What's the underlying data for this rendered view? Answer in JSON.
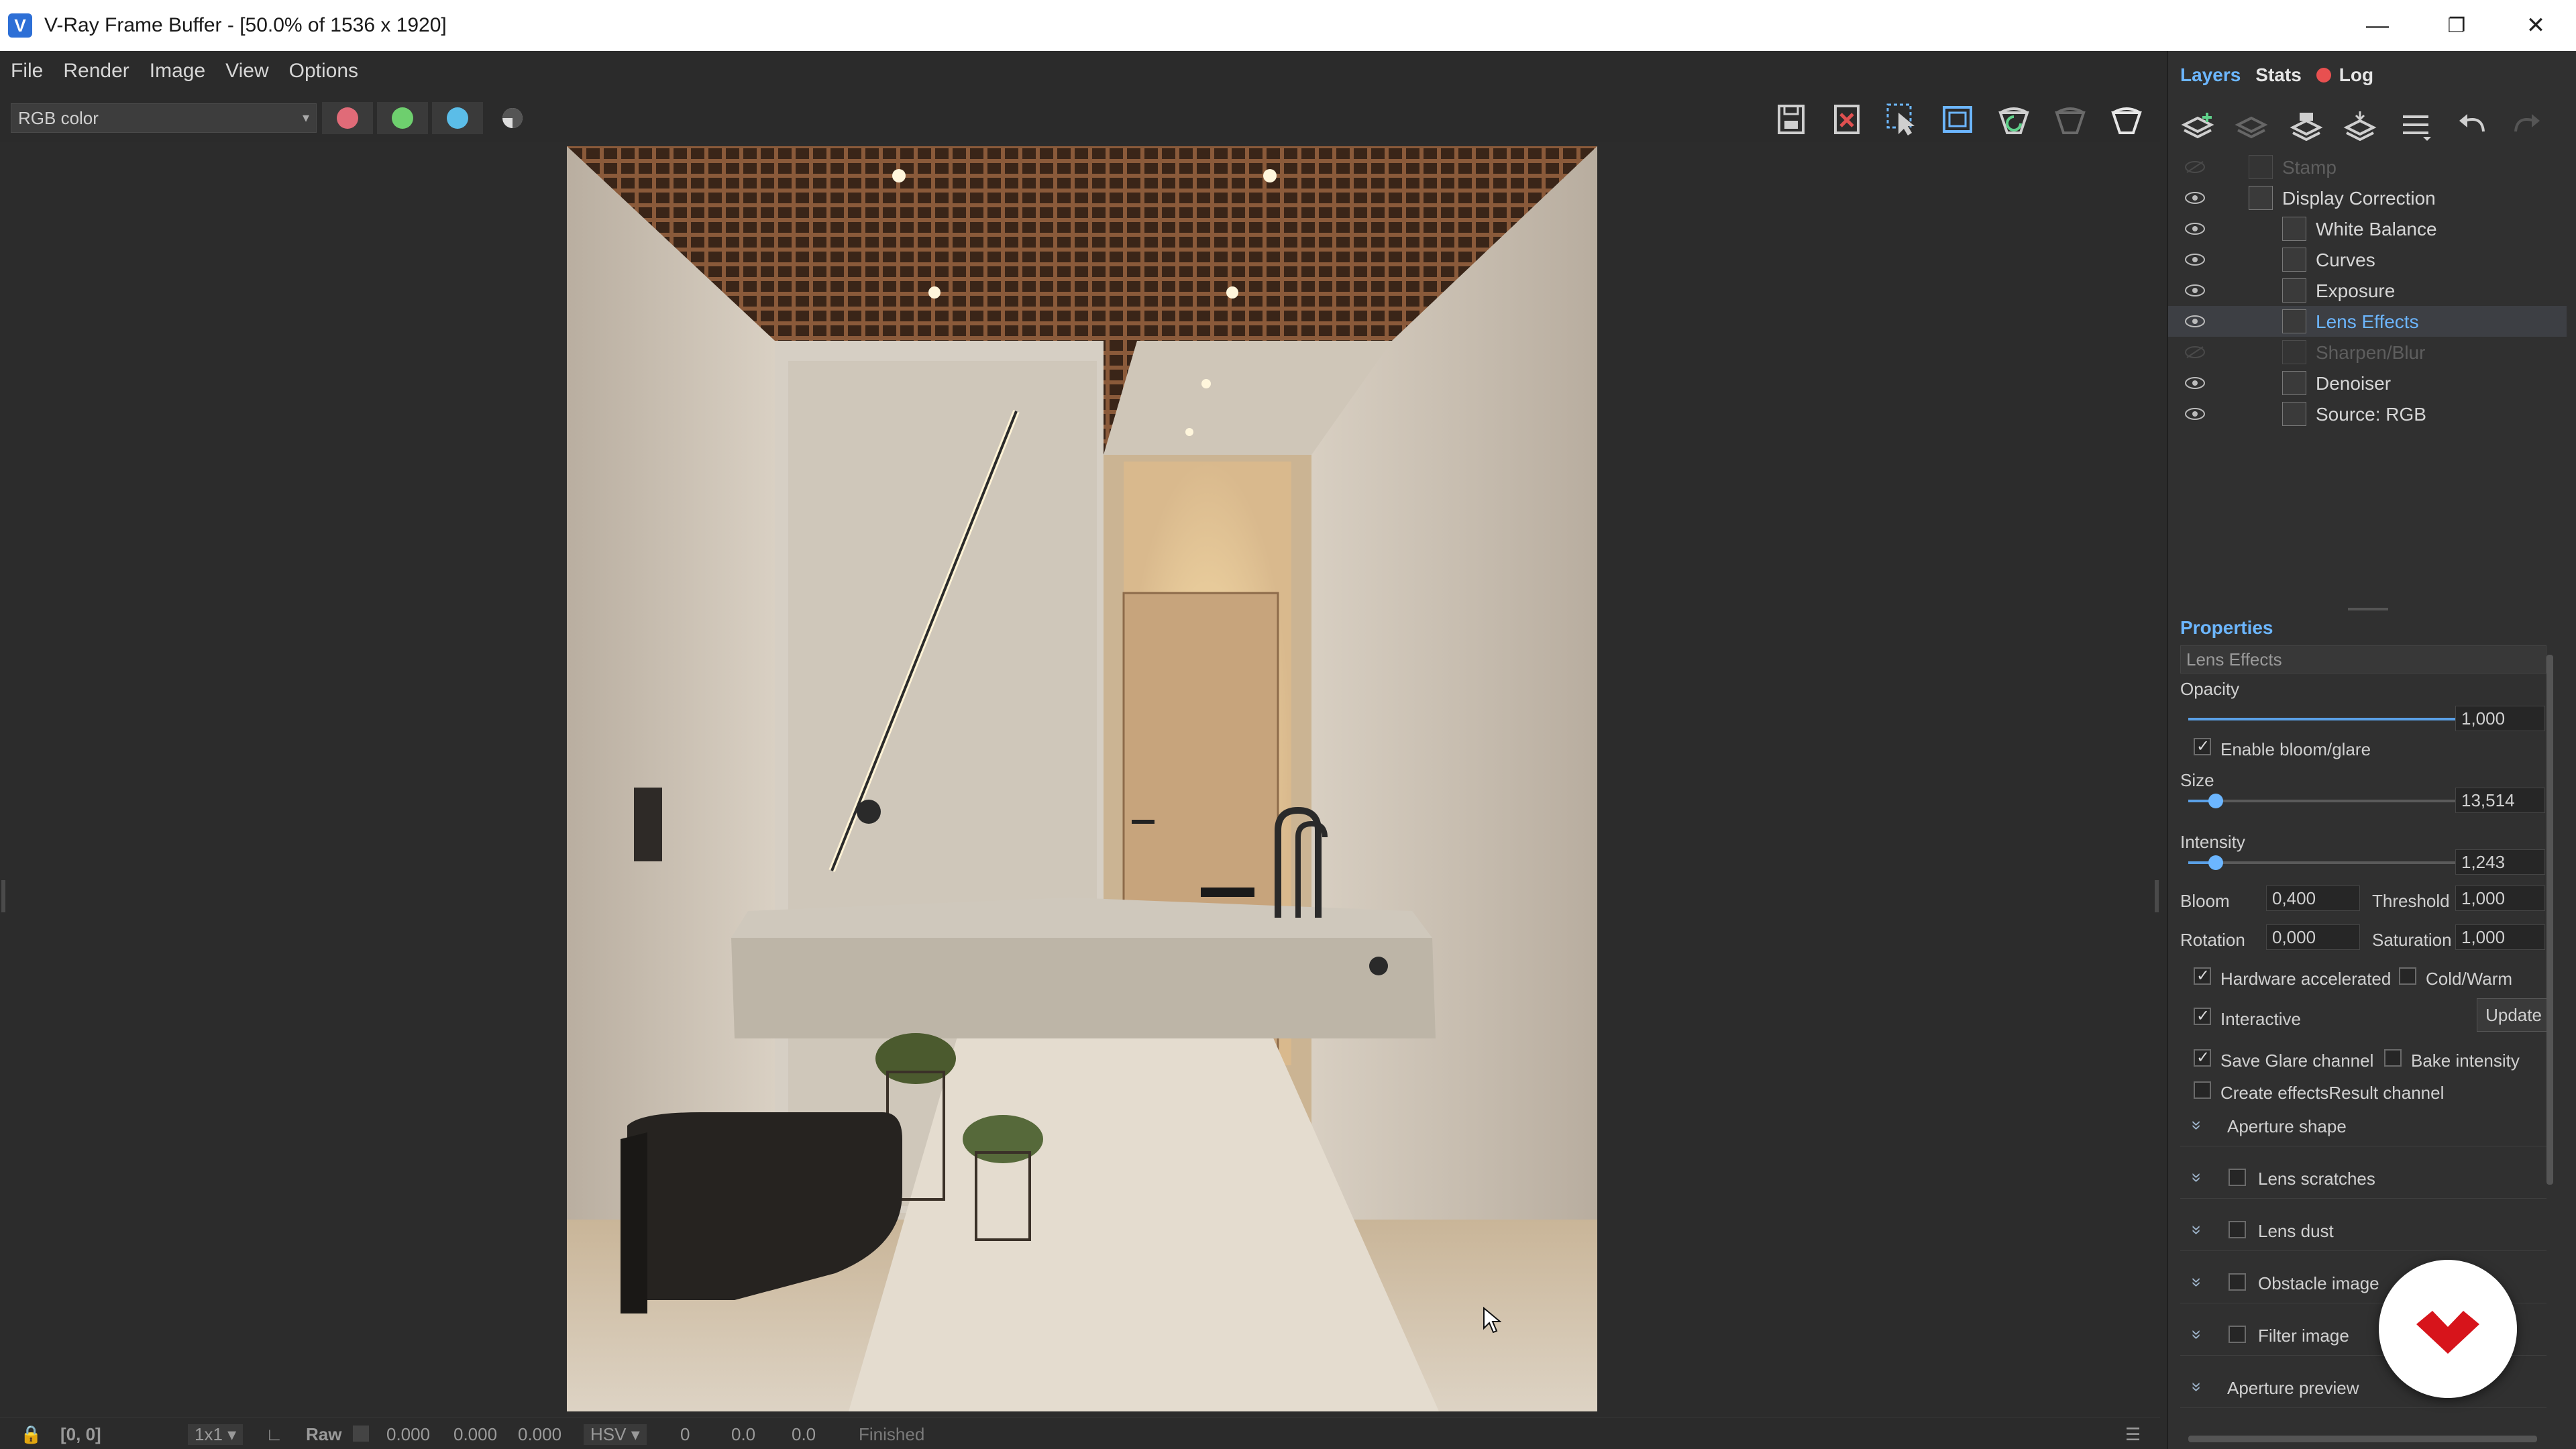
{
  "window": {
    "title": "V-Ray Frame Buffer - [50.0% of 1536 x 1920]",
    "minimize_glyph": "—",
    "maximize_glyph": "❐",
    "close_glyph": "✕"
  },
  "menu": [
    "File",
    "Render",
    "Image",
    "View",
    "Options"
  ],
  "toolbar": {
    "channel": "RGB color",
    "channel_buttons": [
      {
        "name": "red-channel",
        "color": "#e06b78"
      },
      {
        "name": "green-channel",
        "color": "#6ecf6e"
      },
      {
        "name": "blue-channel",
        "color": "#5bbde8"
      },
      {
        "name": "alpha-channel",
        "color": "#dddddd"
      }
    ],
    "right_icons": [
      "save-image-icon",
      "clear-image-icon",
      "track-mouse-icon",
      "region-render-icon",
      "render-last-icon",
      "stop-render-icon",
      "render-icon"
    ]
  },
  "panel": {
    "tabs": [
      {
        "label": "Layers",
        "active": true,
        "color": "#6cb6ff"
      },
      {
        "label": "Stats",
        "active": false,
        "color": "#e6e6e6"
      },
      {
        "label": "Log",
        "active": false,
        "color": "#e6e6e6",
        "indicator_color": "#e85050"
      }
    ],
    "layer_tools": [
      "add-layer-icon",
      "remove-layer-icon",
      "save-layers-icon",
      "load-layers-icon",
      "layer-list-icon",
      "undo-icon",
      "redo-icon"
    ],
    "layers": [
      {
        "label": "Stamp",
        "indent": 0,
        "visible": false,
        "dim": true,
        "selected": false,
        "icon": "stamp-icon"
      },
      {
        "label": "Display Correction",
        "indent": 0,
        "visible": true,
        "dim": false,
        "selected": false,
        "icon": "display-correction-icon"
      },
      {
        "label": "White Balance",
        "indent": 1,
        "visible": true,
        "dim": false,
        "selected": false,
        "icon": "white-balance-icon"
      },
      {
        "label": "Curves",
        "indent": 1,
        "visible": true,
        "dim": false,
        "selected": false,
        "icon": "curves-icon"
      },
      {
        "label": "Exposure",
        "indent": 1,
        "visible": true,
        "dim": false,
        "selected": false,
        "icon": "exposure-icon"
      },
      {
        "label": "Lens Effects",
        "indent": 1,
        "visible": true,
        "dim": false,
        "selected": true,
        "icon": "lens-effects-icon"
      },
      {
        "label": "Sharpen/Blur",
        "indent": 1,
        "visible": false,
        "dim": true,
        "selected": false,
        "icon": "sharpen-blur-icon"
      },
      {
        "label": "Denoiser",
        "indent": 1,
        "visible": true,
        "dim": false,
        "selected": false,
        "icon": "denoiser-icon"
      },
      {
        "label": "Source: RGB",
        "indent": 1,
        "visible": true,
        "dim": false,
        "selected": false,
        "icon": "source-rgb-icon"
      }
    ]
  },
  "properties": {
    "header": "Properties",
    "layer_name": "Lens Effects",
    "opacity_label": "Opacity",
    "opacity": "1,000",
    "opacity_level": 1.0,
    "enable_bloom": {
      "label": "Enable bloom/glare",
      "checked": true
    },
    "size_label": "Size",
    "size": "13,514",
    "size_level": 0.1,
    "intensity_label": "Intensity",
    "intensity": "1,243",
    "intensity_level": 0.1,
    "bloom_label": "Bloom",
    "bloom": "0,400",
    "threshold_label": "Threshold",
    "threshold": "1,000",
    "rotation_label": "Rotation",
    "rotation": "0,000",
    "saturation_label": "Saturation",
    "saturation": "1,000",
    "hardware_accelerated": {
      "label": "Hardware accelerated",
      "checked": true
    },
    "cold_warm": {
      "label": "Cold/Warm",
      "checked": false
    },
    "interactive": {
      "label": "Interactive",
      "checked": true
    },
    "update_label": "Update",
    "save_glare": {
      "label": "Save Glare channel",
      "checked": true
    },
    "bake_intensity": {
      "label": "Bake intensity",
      "checked": false
    },
    "create_effects": {
      "label": "Create effectsResult channel",
      "checked": false
    },
    "sections": [
      {
        "label": "Aperture shape",
        "has_checkbox": false
      },
      {
        "label": "Lens scratches",
        "has_checkbox": true
      },
      {
        "label": "Lens dust",
        "has_checkbox": true
      },
      {
        "label": "Obstacle image",
        "has_checkbox": true
      },
      {
        "label": "Filter image",
        "has_checkbox": true
      },
      {
        "label": "Aperture preview",
        "has_checkbox": false
      }
    ]
  },
  "statusbar": {
    "coords": "[0, 0]",
    "zoom": "1x1",
    "raw": "Raw",
    "rgb": [
      "0.000",
      "0.000",
      "0.000"
    ],
    "color_mode": "HSV",
    "hsv": [
      "0",
      "0.0",
      "0.0"
    ],
    "status": "Finished"
  },
  "colors": {
    "accent": "#6cb6ff",
    "panel_bg": "#303030",
    "selected_row": "#3d3f44",
    "brand_red": "#d7141b"
  }
}
